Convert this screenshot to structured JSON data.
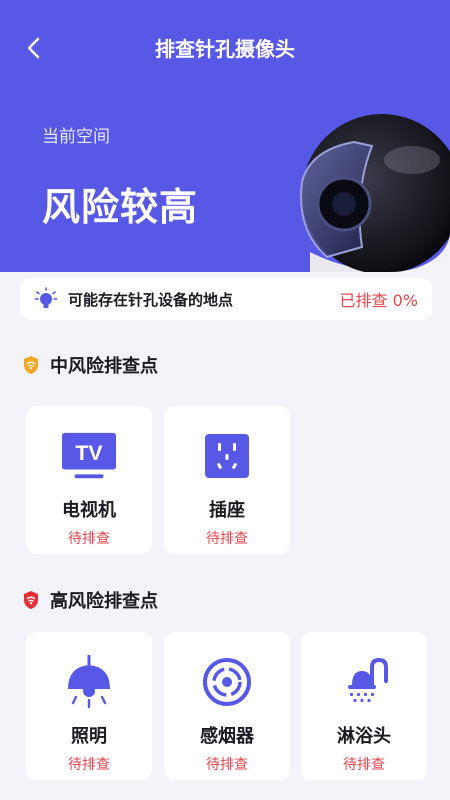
{
  "header": {
    "title": "排查针孔摄像头",
    "space_label": "当前空间",
    "risk_level": "风险较高"
  },
  "info_bar": {
    "text": "可能存在针孔设备的地点",
    "progress": "已排查 0%"
  },
  "sections": [
    {
      "title": "中风险排查点",
      "shield_color": "#f2a623",
      "items": [
        {
          "name": "电视机",
          "status": "待排查",
          "icon": "tv-icon"
        },
        {
          "name": "插座",
          "status": "待排查",
          "icon": "socket-icon"
        }
      ]
    },
    {
      "title": "高风险排查点",
      "shield_color": "#e3303a",
      "items": [
        {
          "name": "照明",
          "status": "待排查",
          "icon": "lamp-icon"
        },
        {
          "name": "感烟器",
          "status": "待排查",
          "icon": "smoke-detector-icon"
        },
        {
          "name": "淋浴头",
          "status": "待排查",
          "icon": "shower-icon"
        }
      ]
    }
  ],
  "colors": {
    "accent": "#5858e6",
    "warning": "#e3474f",
    "background": "#f3f3f9"
  },
  "tv_icon_text": "TV"
}
